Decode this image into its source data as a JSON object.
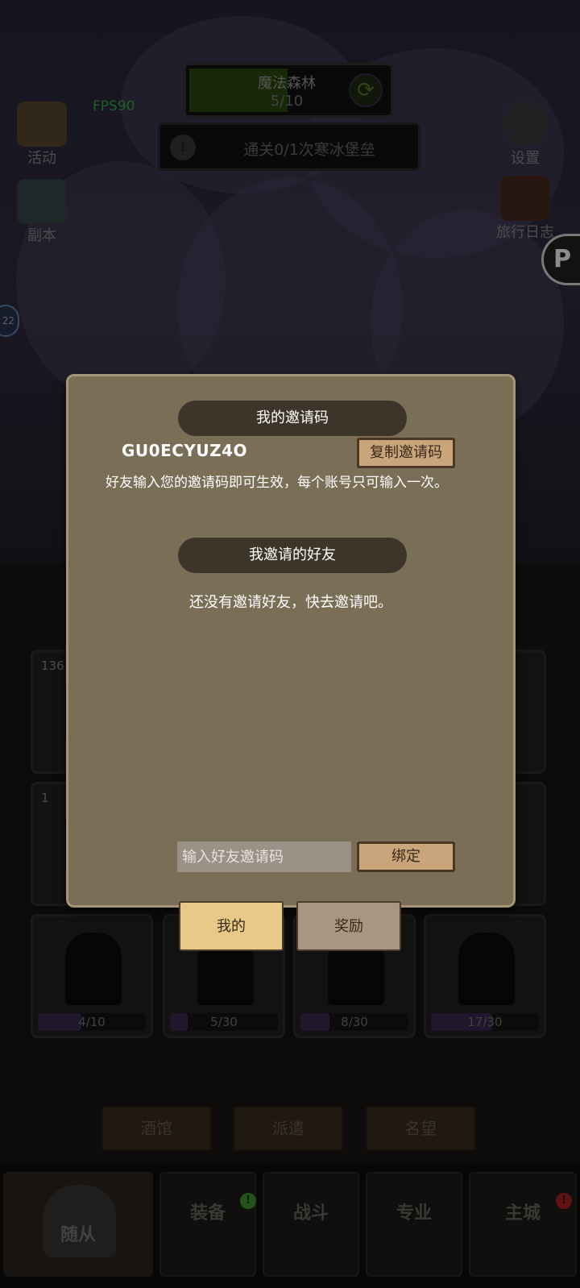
{
  "hud": {
    "stage_name": "魔法森林",
    "stage_progress": "5/10",
    "quest_text": "通关0/1次寒冰堡垒",
    "fps": "FPS90",
    "left_icons": [
      {
        "label": "活动",
        "icon": "scroll-board-icon"
      },
      {
        "label": "副本",
        "icon": "portal-crystal-icon"
      }
    ],
    "right_icons": [
      {
        "label": "设置",
        "icon": "gear-icon"
      },
      {
        "label": "旅行日志",
        "icon": "journal-book-icon"
      }
    ],
    "side_bubble": "22"
  },
  "followers": {
    "cards": [
      {
        "count": "136",
        "progress": ""
      },
      {
        "count": "",
        "progress": ""
      },
      {
        "count": "",
        "progress": ""
      },
      {
        "count": "",
        "progress": ""
      },
      {
        "count": "1",
        "progress": ""
      },
      {
        "count": "",
        "progress": ""
      },
      {
        "count": "",
        "progress": ""
      },
      {
        "count": "",
        "progress": ""
      },
      {
        "count": "",
        "progress": "4/10",
        "fill": 0.4
      },
      {
        "count": "",
        "progress": "5/30",
        "fill": 0.1667
      },
      {
        "count": "",
        "progress": "8/30",
        "fill": 0.2667
      },
      {
        "count": "",
        "progress": "17/30",
        "fill": 0.5667
      }
    ],
    "subtabs": [
      "酒馆",
      "派遣",
      "名望"
    ]
  },
  "bottom_nav": {
    "items": [
      "随从",
      "装备",
      "战斗",
      "专业",
      "主城"
    ],
    "active": "随从",
    "badge_colors": {
      "equip": "#3f9a2e",
      "city": "#b02323"
    }
  },
  "dialog": {
    "my_code_title": "我的邀请码",
    "invite_code": "GU0ECYUZ4O",
    "copy_button": "复制邀请码",
    "hint": "好友输入您的邀请码即可生效，每个账号只可输入一次。",
    "friends_title": "我邀请的好友",
    "empty_text": "还没有邀请好友，快去邀请吧。",
    "input_placeholder": "输入好友邀请码",
    "input_value": "",
    "bind_button": "绑定",
    "tabs": [
      "我的",
      "奖励"
    ],
    "active_tab": "我的"
  }
}
